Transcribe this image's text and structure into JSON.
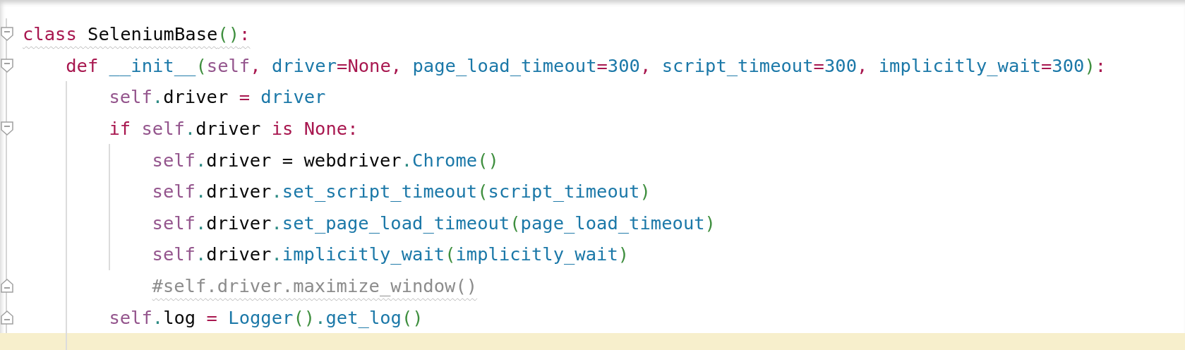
{
  "editor": {
    "lines": [
      {
        "fold_start": true,
        "fold_end": false,
        "warning": true,
        "current": false,
        "tokens": [
          {
            "t": "class",
            "kind": "kw"
          },
          {
            "t": " SeleniumBase",
            "kind": "name"
          },
          {
            "t": "()",
            "kind": "paren"
          },
          {
            "t": ":",
            "kind": "kw"
          }
        ],
        "children": [
          {
            "fold_start": true,
            "fold_end": false,
            "warning": false,
            "current": false,
            "tokens": [
              {
                "t": "def",
                "kind": "kw"
              },
              {
                "t": " __init__",
                "kind": "fn"
              },
              {
                "t": "(",
                "kind": "paren"
              },
              {
                "t": "self",
                "kind": "self"
              },
              {
                "t": ",",
                "kind": "kw"
              },
              {
                "t": " driver",
                "kind": "fn"
              },
              {
                "t": "=None,",
                "kind": "kw"
              },
              {
                "t": " page_load_timeout",
                "kind": "fn"
              },
              {
                "t": "=",
                "kind": "kw"
              },
              {
                "t": "300",
                "kind": "fn"
              },
              {
                "t": ",",
                "kind": "kw"
              },
              {
                "t": " script_timeout",
                "kind": "fn"
              },
              {
                "t": "=",
                "kind": "kw"
              },
              {
                "t": "300",
                "kind": "fn"
              },
              {
                "t": ",",
                "kind": "kw"
              },
              {
                "t": " implicitly_wait",
                "kind": "fn"
              },
              {
                "t": "=",
                "kind": "kw"
              },
              {
                "t": "300",
                "kind": "fn"
              },
              {
                "t": ")",
                "kind": "paren"
              },
              {
                "t": ":",
                "kind": "kw"
              }
            ],
            "children": [
              {
                "fold_start": false,
                "fold_end": false,
                "warning": false,
                "current": false,
                "tokens": [
                  {
                    "t": "self",
                    "kind": "self"
                  },
                  {
                    "t": ".",
                    "kind": "dot"
                  },
                  {
                    "t": "driver ",
                    "kind": "name"
                  },
                  {
                    "t": "=",
                    "kind": "kw"
                  },
                  {
                    "t": " driver",
                    "kind": "fn"
                  }
                ]
              },
              {
                "fold_start": true,
                "fold_end": false,
                "warning": false,
                "current": false,
                "tokens": [
                  {
                    "t": "if ",
                    "kind": "kw"
                  },
                  {
                    "t": "self",
                    "kind": "self"
                  },
                  {
                    "t": ".",
                    "kind": "dot"
                  },
                  {
                    "t": "driver ",
                    "kind": "name"
                  },
                  {
                    "t": "is None:",
                    "kind": "kw"
                  }
                ],
                "children": [
                  {
                    "fold_start": false,
                    "fold_end": false,
                    "warning": false,
                    "current": false,
                    "tokens": [
                      {
                        "t": "self",
                        "kind": "self"
                      },
                      {
                        "t": ".",
                        "kind": "dot"
                      },
                      {
                        "t": "driver = webdriver",
                        "kind": "name"
                      },
                      {
                        "t": ".",
                        "kind": "dot"
                      },
                      {
                        "t": "Chrome",
                        "kind": "fn"
                      },
                      {
                        "t": "()",
                        "kind": "paren"
                      }
                    ]
                  },
                  {
                    "fold_start": false,
                    "fold_end": false,
                    "warning": false,
                    "current": false,
                    "tokens": [
                      {
                        "t": "self",
                        "kind": "self"
                      },
                      {
                        "t": ".",
                        "kind": "dot"
                      },
                      {
                        "t": "driver",
                        "kind": "name"
                      },
                      {
                        "t": ".",
                        "kind": "dot"
                      },
                      {
                        "t": "set_script_timeout",
                        "kind": "fn"
                      },
                      {
                        "t": "(",
                        "kind": "paren"
                      },
                      {
                        "t": "script_timeout",
                        "kind": "fn"
                      },
                      {
                        "t": ")",
                        "kind": "paren"
                      }
                    ]
                  },
                  {
                    "fold_start": false,
                    "fold_end": false,
                    "warning": false,
                    "current": false,
                    "tokens": [
                      {
                        "t": "self",
                        "kind": "self"
                      },
                      {
                        "t": ".",
                        "kind": "dot"
                      },
                      {
                        "t": "driver",
                        "kind": "name"
                      },
                      {
                        "t": ".",
                        "kind": "dot"
                      },
                      {
                        "t": "set_page_load_timeout",
                        "kind": "fn"
                      },
                      {
                        "t": "(",
                        "kind": "paren"
                      },
                      {
                        "t": "page_load_timeout",
                        "kind": "fn"
                      },
                      {
                        "t": ")",
                        "kind": "paren"
                      }
                    ]
                  },
                  {
                    "fold_start": false,
                    "fold_end": false,
                    "warning": false,
                    "current": false,
                    "tokens": [
                      {
                        "t": "self",
                        "kind": "self"
                      },
                      {
                        "t": ".",
                        "kind": "dot"
                      },
                      {
                        "t": "driver",
                        "kind": "name"
                      },
                      {
                        "t": ".",
                        "kind": "dot"
                      },
                      {
                        "t": "implicitly_wait",
                        "kind": "fn"
                      },
                      {
                        "t": "(",
                        "kind": "paren"
                      },
                      {
                        "t": "implicitly_wait",
                        "kind": "fn"
                      },
                      {
                        "t": ")",
                        "kind": "paren"
                      }
                    ]
                  },
                  {
                    "fold_start": false,
                    "fold_end": true,
                    "warning": true,
                    "current": false,
                    "tokens": [
                      {
                        "t": "#self.driver.maximize_window()",
                        "kind": "comment"
                      }
                    ]
                  }
                ]
              },
              {
                "fold_start": false,
                "fold_end": true,
                "warning": false,
                "current": false,
                "tokens": [
                  {
                    "t": "self",
                    "kind": "self"
                  },
                  {
                    "t": ".",
                    "kind": "dot"
                  },
                  {
                    "t": "log ",
                    "kind": "name"
                  },
                  {
                    "t": "=",
                    "kind": "kw"
                  },
                  {
                    "t": " Logger",
                    "kind": "fn"
                  },
                  {
                    "t": "()",
                    "kind": "paren"
                  },
                  {
                    "t": ".",
                    "kind": "dot"
                  },
                  {
                    "t": "get_log",
                    "kind": "fn"
                  },
                  {
                    "t": "()",
                    "kind": "paren"
                  }
                ]
              },
              {
                "fold_start": false,
                "fold_end": false,
                "warning": false,
                "current": true
              }
            ]
          }
        ]
      }
    ]
  }
}
